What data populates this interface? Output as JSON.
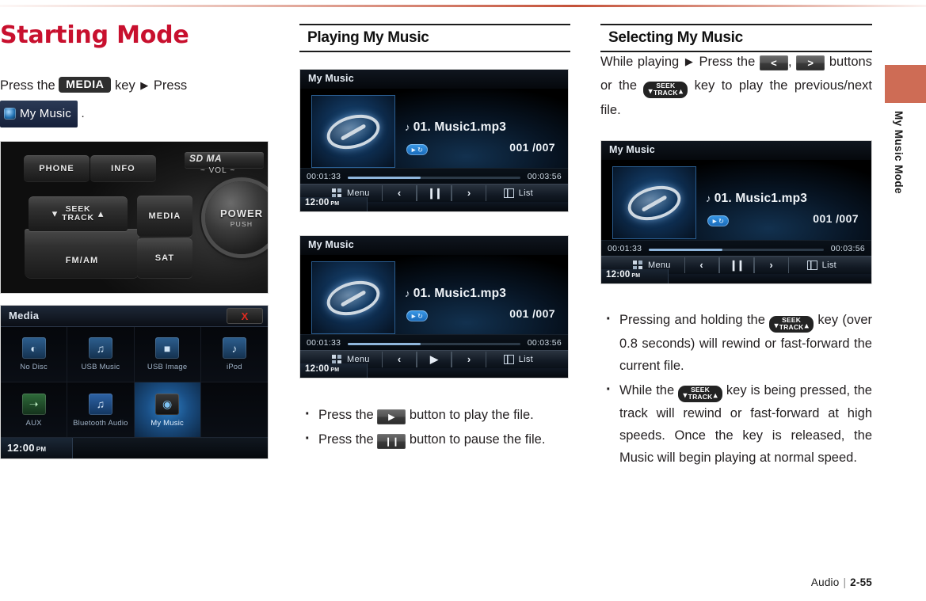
{
  "page": {
    "title": "Starting Mode",
    "side_tab_label": "My Music Mode",
    "accent_color": "#ce6c55",
    "title_color": "#c8102e"
  },
  "footer": {
    "section": "Audio",
    "separator": "|",
    "page_number": "2-55"
  },
  "left_column": {
    "intro": {
      "before_key": "Press the",
      "key_label": "MEDIA",
      "after_key": "key",
      "arrow": "▶",
      "press": "Press",
      "menu_badge_label": "My Music",
      "menu_badge_icon": "disc-icon",
      "period": "."
    },
    "control_panel": {
      "caption": "head-unit-control-panel",
      "buttons": [
        {
          "name": "phone",
          "label": "PHONE"
        },
        {
          "name": "info",
          "label": "INFO"
        },
        {
          "name": "seek-track",
          "label": "SEEK TRACK",
          "line1": "SEEK",
          "line2": "TRACK",
          "left_chevron": "⌄",
          "right_chevron": "⌃"
        },
        {
          "name": "fm-am",
          "label": "FM/AM"
        },
        {
          "name": "media",
          "label": "MEDIA"
        },
        {
          "name": "sat",
          "label": "SAT"
        }
      ],
      "sd_slot_label": "SD MA",
      "vol_label": "VOL",
      "knob": {
        "primary": "POWER",
        "secondary": "PUSH"
      }
    },
    "media_screen": {
      "title": "Media",
      "close_label": "X",
      "clock": "12:00",
      "clock_meridiem": "PM",
      "sources": [
        {
          "label": "No Disc",
          "icon": "disc-icon",
          "selected": false
        },
        {
          "label": "USB Music",
          "icon": "usb-music-icon",
          "selected": false
        },
        {
          "label": "USB Image",
          "icon": "usb-image-icon",
          "selected": false
        },
        {
          "label": "iPod",
          "icon": "ipod-icon",
          "selected": false
        },
        {
          "label": "AUX",
          "icon": "aux-icon",
          "selected": false
        },
        {
          "label": "Bluetooth Audio",
          "icon": "bluetooth-icon",
          "selected": false
        },
        {
          "label": "My Music",
          "icon": "my-music-icon",
          "selected": true
        },
        {
          "label": "",
          "icon": "",
          "selected": false
        }
      ]
    }
  },
  "middle_column": {
    "heading": "Playing My Music",
    "player_paused": {
      "header_title": "My Music",
      "track_title": "01. Music1.mp3",
      "note_icon": "♪",
      "repeat_mode_icon": "repeat-one-icon",
      "track_counter": "001 /007",
      "elapsed_time": "00:01:33",
      "total_time": "00:03:56",
      "progress_percent": 42,
      "menu_label": "Menu",
      "list_label": "List",
      "prev_label": "‹",
      "play_pause_state": "pause",
      "next_label": "›",
      "clock": "12:00",
      "clock_meridiem": "PM"
    },
    "player_playing": {
      "header_title": "My Music",
      "track_title": "01. Music1.mp3",
      "note_icon": "♪",
      "repeat_mode_icon": "repeat-one-icon",
      "track_counter": "001 /007",
      "elapsed_time": "00:01:33",
      "total_time": "00:03:56",
      "progress_percent": 42,
      "menu_label": "Menu",
      "list_label": "List",
      "prev_label": "‹",
      "play_pause_state": "play",
      "next_label": "›",
      "clock": "12:00",
      "clock_meridiem": "PM"
    },
    "bullets": [
      {
        "before": "Press the",
        "button": "play",
        "after": "button to play the file."
      },
      {
        "before": "Press the",
        "button": "pause",
        "after": "button to pause the file."
      }
    ]
  },
  "right_column": {
    "heading": "Selecting My Music",
    "intro": {
      "part1": "While playing",
      "arrow": "▶",
      "part2": "Press the",
      "btn_prev": "<",
      "comma": ",",
      "btn_next": ">",
      "part3": "buttons or the",
      "seek_line1": "SEEK",
      "seek_line2": "TRACK",
      "part4": "key to play the previous/next file."
    },
    "player": {
      "header_title": "My Music",
      "track_title": "01. Music1.mp3",
      "note_icon": "♪",
      "repeat_mode_icon": "repeat-one-icon",
      "track_counter": "001 /007",
      "elapsed_time": "00:01:33",
      "total_time": "00:03:56",
      "progress_percent": 42,
      "menu_label": "Menu",
      "list_label": "List",
      "prev_label": "‹",
      "play_pause_state": "pause",
      "next_label": "›",
      "clock": "12:00",
      "clock_meridiem": "PM"
    },
    "bullets": [
      {
        "before": "Pressing and holding the",
        "seek_line1": "SEEK",
        "seek_line2": "TRACK",
        "after": "key (over 0.8 seconds) will rewind or fast-forward the current file."
      },
      {
        "before": "While the",
        "seek_line1": "SEEK",
        "seek_line2": "TRACK",
        "after": "key is being pressed, the track will rewind or fast-forward at high speeds. Once the key is released, the Music will begin playing at normal speed."
      }
    ]
  }
}
